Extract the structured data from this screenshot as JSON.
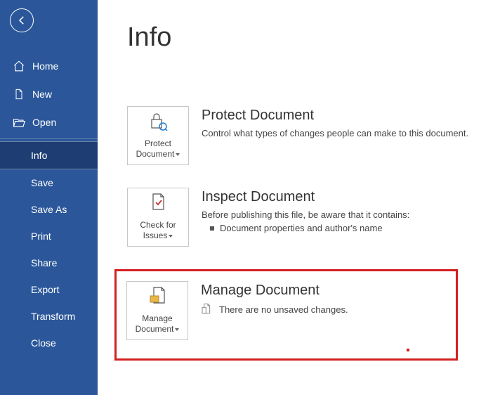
{
  "page": {
    "title": "Info"
  },
  "sidebar": {
    "top": [
      {
        "label": "Home"
      },
      {
        "label": "New"
      },
      {
        "label": "Open"
      }
    ],
    "bottom": [
      {
        "label": "Info"
      },
      {
        "label": "Save"
      },
      {
        "label": "Save As"
      },
      {
        "label": "Print"
      },
      {
        "label": "Share"
      },
      {
        "label": "Export"
      },
      {
        "label": "Transform"
      },
      {
        "label": "Close"
      }
    ]
  },
  "sections": {
    "protect": {
      "tile_l1": "Protect",
      "tile_l2": "Document",
      "title": "Protect Document",
      "desc": "Control what types of changes people can make to this document."
    },
    "inspect": {
      "tile_l1": "Check for",
      "tile_l2": "Issues",
      "title": "Inspect Document",
      "desc": "Before publishing this file, be aware that it contains:",
      "bullet1": "Document properties and author's name"
    },
    "manage": {
      "tile_l1": "Manage",
      "tile_l2": "Document",
      "title": "Manage Document",
      "status": "There are no unsaved changes."
    }
  }
}
